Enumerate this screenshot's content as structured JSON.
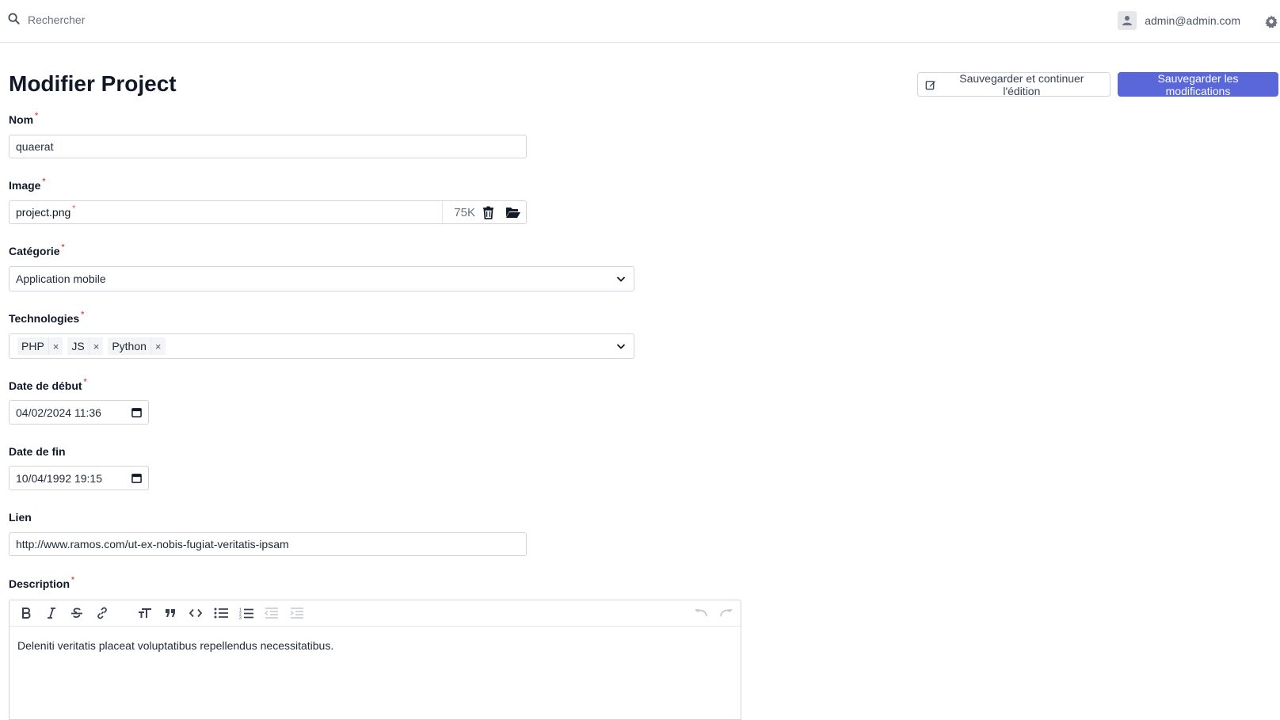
{
  "topbar": {
    "search_placeholder": "Rechercher",
    "user_email": "admin@admin.com"
  },
  "page": {
    "title": "Modifier Project"
  },
  "actions": {
    "save_continue_label": "Sauvegarder et continuer l'édition",
    "save_label": "Sauvegarder les modifications"
  },
  "form": {
    "nom": {
      "label": "Nom",
      "value": "quaerat"
    },
    "image": {
      "label": "Image",
      "filename": "project.png",
      "size": "75K"
    },
    "categorie": {
      "label": "Catégorie",
      "value": "Application mobile"
    },
    "technologies": {
      "label": "Technologies",
      "tags": [
        "PHP",
        "JS",
        "Python"
      ]
    },
    "date_debut": {
      "label": "Date de début",
      "value": "04/02/2024 11:36"
    },
    "date_fin": {
      "label": "Date de fin",
      "value": "10/04/1992 19:15"
    },
    "lien": {
      "label": "Lien",
      "value": "http://www.ramos.com/ut-ex-nobis-fugiat-veritatis-ipsam"
    },
    "description": {
      "label": "Description",
      "content": "Deleniti veritatis placeat voluptatibus repellendus necessitatibus."
    }
  },
  "required_mark": "*",
  "colors": {
    "primary": "#5a67d8",
    "required": "#ef4444",
    "border": "#d1d5db"
  }
}
